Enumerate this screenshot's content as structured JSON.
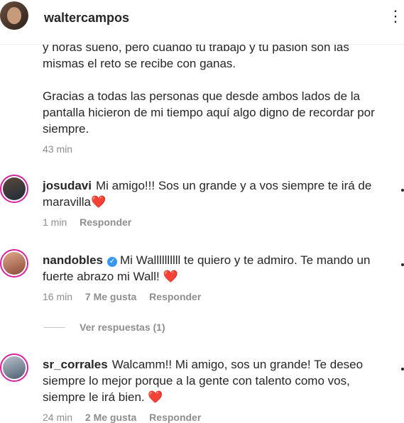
{
  "header": {
    "username": "waltercampos",
    "more_icon": "more-icon"
  },
  "caption": {
    "text_line1": "y horas sueño, pero cuando tu trabajo y tu pasión son las",
    "text_line2": "mismas el reto se recibe con ganas.",
    "text_line3": "Gracias a todas las personas que desde ambos lados de la pantalla hicieron de mi tiempo aquí algo digno de recordar por siempre.",
    "time": "43 min"
  },
  "comments": [
    {
      "username": "josudavi",
      "verified": false,
      "text": "Mi amigo!!! Sos un grande y a vos siempre te irá de maravilla",
      "heart": "❤️",
      "time": "1 min",
      "likes": "",
      "reply_label": "Responder"
    },
    {
      "username": "nandobles",
      "verified": true,
      "text": "Mi Wallllllllll te quiero y te admiro. Te mando un fuerte abrazo mi Wall!",
      "heart": "❤️",
      "time": "16 min",
      "likes": "7 Me gusta",
      "reply_label": "Responder",
      "view_replies": "Ver respuestas (1)"
    },
    {
      "username": "sr_corrales",
      "verified": false,
      "text": "Walcamm!! Mi amigo, sos un grande! Te deseo siempre lo mejor porque a la gente con talento como vos, siempre le irá bien.",
      "heart": "❤️",
      "time": "24 min",
      "likes": "2 Me gusta",
      "reply_label": "Responder"
    }
  ],
  "colors": {
    "text": "#262626",
    "muted": "#8e8e8e",
    "heart": "#ed4956",
    "verified": "#3897f0",
    "story_ring": "#d6249f"
  }
}
